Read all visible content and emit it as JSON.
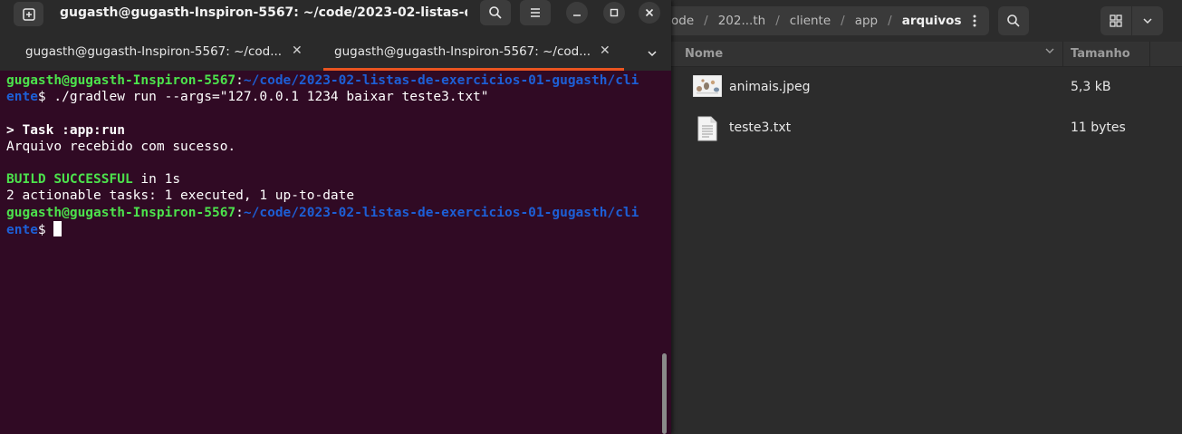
{
  "terminal": {
    "title": "gugasth@gugasth-Inspiron-5567: ~/code/2023-02-listas-de-e...",
    "tabs": [
      {
        "label": "gugasth@gugasth-Inspiron-5567: ~/cod...",
        "active": false
      },
      {
        "label": "gugasth@gugasth-Inspiron-5567: ~/cod...",
        "active": true
      }
    ],
    "lines": {
      "l1_user": "gugasth@gugasth-Inspiron-5567",
      "l1_path": "~/code/2023-02-listas-de-exercicios-01-gugasth/cli",
      "l2_path": "ente",
      "l2_cmd": "$ ./gradlew run --args=\"127.0.0.1 1234 baixar teste3.txt\"",
      "l4_task": "> Task :app:run",
      "l5": "Arquivo recebido com sucesso.",
      "l7_build": "BUILD SUCCESSFUL",
      "l7_rest": " in 1s",
      "l8": "2 actionable tasks: 1 executed, 1 up-to-date",
      "l9_user": "gugasth@gugasth-Inspiron-5567",
      "l9_path": "~/code/2023-02-listas-de-exercicios-01-gugasth/cli",
      "l10_path": "ente",
      "l10_prompt": "$ ",
      "colon": ":"
    },
    "colors": {
      "background": "#300a24",
      "user": "#4ce24c",
      "path": "#1d5fd6",
      "tab_accent": "#e95420"
    }
  },
  "files": {
    "breadcrumb": [
      "ode",
      "202...th",
      "cliente",
      "app"
    ],
    "breadcrumb_current": "arquivos",
    "breadcrumb_sep": "/",
    "columns": {
      "name": "Nome",
      "size": "Tamanho"
    },
    "items": [
      {
        "name": "animais.jpeg",
        "size": "5,3 kB",
        "icon": "image-thumbnail-icon"
      },
      {
        "name": "teste3.txt",
        "size": "11 bytes",
        "icon": "text-file-icon"
      }
    ]
  }
}
